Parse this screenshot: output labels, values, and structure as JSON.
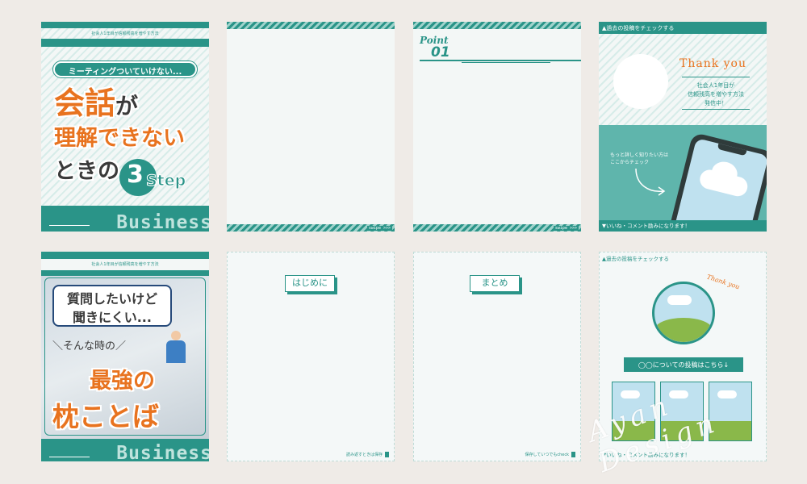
{
  "card1": {
    "header": "社会人1年目が信頼残高を増やす方法",
    "subtitle": "ミーティングついていけない...",
    "title_a": "会話",
    "title_b": "が",
    "title_line2": "理解できない",
    "title_line3": "ときの",
    "step_num": "3",
    "step_word": "Step",
    "footer": "Business"
  },
  "card2": {
    "swipe": "swipe >>>"
  },
  "card3": {
    "point_word": "Point",
    "point_num": "01",
    "swipe": "swipe >>>"
  },
  "card4": {
    "header": "▲過去の投稿をチェックする",
    "thanks": "Thank you",
    "line1": "社会人1年目が",
    "line2": "信頼残高を増やす方法",
    "line3": "発信中！",
    "more1": "もっと詳しく知りたい方は",
    "more2": "ここからチェック",
    "footer": "▼いいね・コメント励みになります！"
  },
  "card5": {
    "header": "社会人1年目が信頼残高を増やす方法",
    "bubble1": "質問したいけど",
    "bubble2": "聞きにくい...",
    "sub": "＼そんな時の／",
    "big1": "最強の",
    "big2": "枕ことば",
    "footer": "Business"
  },
  "card6": {
    "label": "はじめに",
    "save": "読み返すときは保存"
  },
  "card7": {
    "label": "まとめ",
    "save": "保存していつでもcheck"
  },
  "card8": {
    "header": "▲過去の投稿をチェックする",
    "thanks": "Thank you",
    "banner": "◯◯についての投稿はこちら↓",
    "footer": "▼いいね・コメント励みになります！"
  },
  "watermark": "Ayan Design",
  "colors": {
    "teal": "#2a9488",
    "orange": "#e8731f",
    "bg": "#efebe7"
  }
}
